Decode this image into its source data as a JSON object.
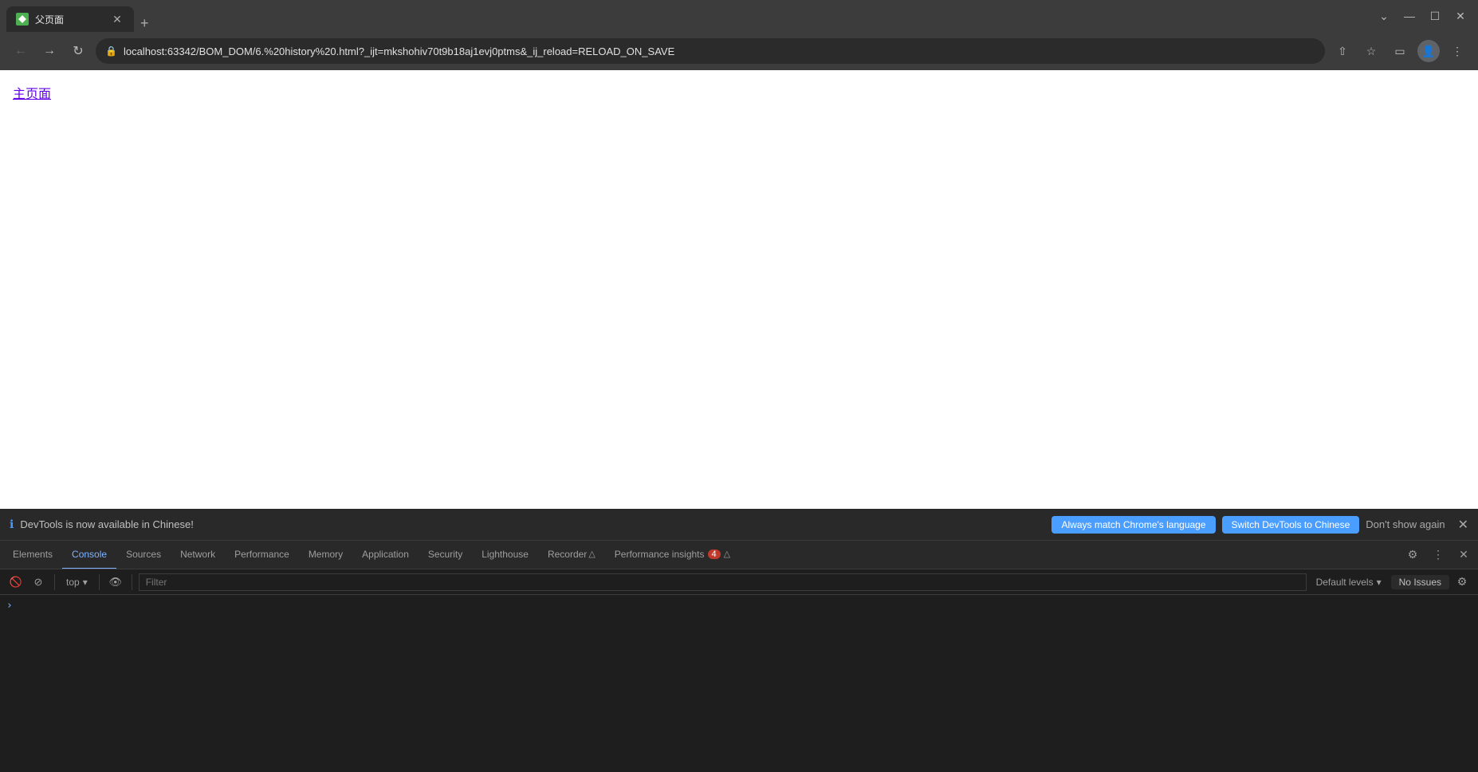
{
  "browser": {
    "tab": {
      "favicon_alt": "favicon",
      "title": "父页面"
    },
    "tab_new_label": "+",
    "window_controls": {
      "minimize": "—",
      "maximize": "☐",
      "close": "✕",
      "dropdown": "⌄"
    },
    "address_bar": {
      "back_disabled": true,
      "url": "localhost:63342/BOM_DOM/6.%20history%20.html?_ijt=mkshohiv70t9b18aj1evj0ptms&_ij_reload=RELOAD_ON_SAVE",
      "lock_icon": "🔒"
    }
  },
  "page": {
    "link_text": "主页面"
  },
  "devtools": {
    "notification": {
      "icon": "ℹ",
      "message": "DevTools is now available in Chinese!",
      "btn_primary": "Always match Chrome's language",
      "btn_secondary": "Switch DevTools to Chinese",
      "dismiss": "Don't show again",
      "close": "✕"
    },
    "tabs": [
      {
        "id": "elements",
        "label": "Elements"
      },
      {
        "id": "console",
        "label": "Console",
        "active": true
      },
      {
        "id": "sources",
        "label": "Sources"
      },
      {
        "id": "network",
        "label": "Network"
      },
      {
        "id": "performance",
        "label": "Performance"
      },
      {
        "id": "memory",
        "label": "Memory"
      },
      {
        "id": "application",
        "label": "Application"
      },
      {
        "id": "security",
        "label": "Security"
      },
      {
        "id": "lighthouse",
        "label": "Lighthouse"
      },
      {
        "id": "recorder",
        "label": "Recorder"
      },
      {
        "id": "performance-insights",
        "label": "Performance insights",
        "badge": "4"
      }
    ],
    "toolbar": {
      "context": "top",
      "filter_placeholder": "Filter",
      "default_levels": "Default levels",
      "no_issues": "No Issues"
    }
  }
}
